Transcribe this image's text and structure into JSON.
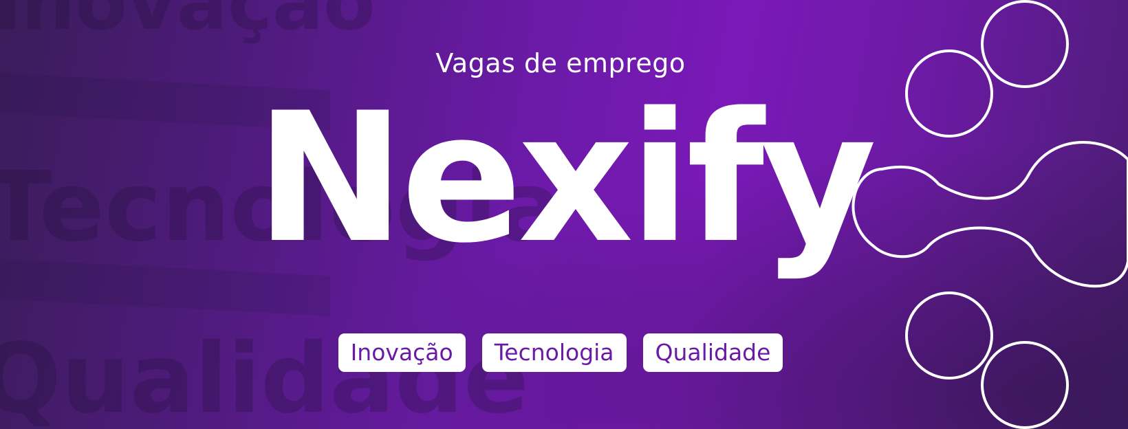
{
  "banner": {
    "subtitle": "Vagas de emprego",
    "title": "Nexify",
    "tags": [
      "Inovação",
      "Tecnologia",
      "Qualidade"
    ],
    "background_words": [
      "Inovação",
      "Tecnologia",
      "Qualidade"
    ]
  },
  "colors": {
    "primary": "#7a19b8",
    "dark": "#3b1c5a",
    "text": "#ffffff",
    "tag_text": "#6a1aa6"
  },
  "decoration": {
    "icon": "circles-network-icon"
  }
}
